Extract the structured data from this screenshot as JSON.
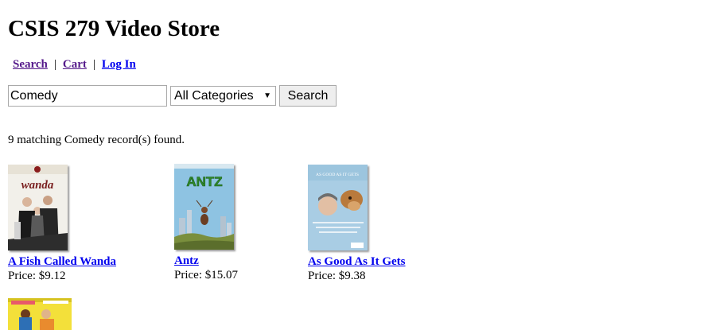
{
  "header": {
    "title": "CSIS 279 Video Store"
  },
  "nav": {
    "search_label": "Search",
    "cart_label": "Cart",
    "login_label": "Log In",
    "separator": "|"
  },
  "search": {
    "query_value": "Comedy",
    "category_selected": "All Categories",
    "button_label": "Search"
  },
  "results": {
    "summary": "9 matching Comedy record(s) found.",
    "items": [
      {
        "title": "A Fish Called Wanda",
        "price_label": "Price: $9.12",
        "cover_art_text": "wanda"
      },
      {
        "title": "Antz",
        "price_label": "Price: $15.07",
        "cover_art_text": "ANTZ"
      },
      {
        "title": "As Good As It Gets",
        "price_label": "Price: $9.38",
        "cover_art_text": "AS GOOD AS IT GETS"
      }
    ]
  },
  "colors": {
    "link_unvisited": "#0000ee",
    "link_visited": "#551a8b"
  }
}
